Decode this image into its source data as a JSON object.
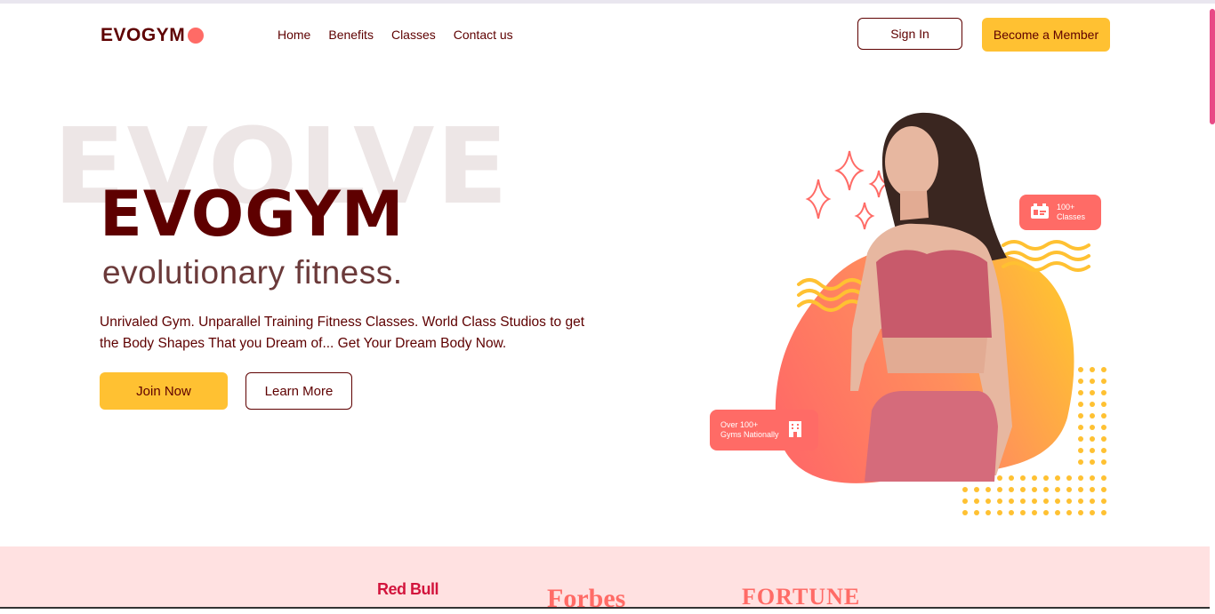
{
  "brand": {
    "name": "EVOGYM",
    "accent": "#ff6b66",
    "primary": "#5e0000",
    "button_yellow": "#ffc132"
  },
  "nav": {
    "links": [
      "Home",
      "Benefits",
      "Classes",
      "Contact us"
    ],
    "sign_in": "Sign In",
    "become_member": "Become a Member"
  },
  "hero": {
    "bg_word": "EVOLVE",
    "title": "EVOGYM",
    "subtitle": "evolutionary fitness.",
    "description": "Unrivaled Gym. Unparallel Training Fitness Classes. World Class Studios to get the Body Shapes That you Dream of... Get Your Dream Body Now.",
    "join_now": "Join Now",
    "learn_more": "Learn More"
  },
  "art": {
    "badge_classes": {
      "line1": "100+",
      "line2": "Classes",
      "icon": "id-card-icon"
    },
    "badge_gyms": {
      "line1": "Over 100+",
      "line2": "Gyms Nationally",
      "icon": "building-icon"
    }
  },
  "sponsors": [
    "Red Bull",
    "Forbes",
    "FORTUNE"
  ]
}
